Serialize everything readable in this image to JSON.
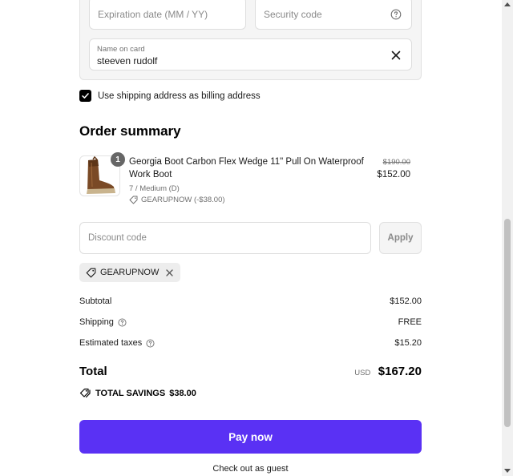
{
  "card": {
    "expiration_placeholder": "Expiration date (MM / YY)",
    "security_placeholder": "Security code",
    "name_label": "Name on card",
    "name_value": "steeven rudolf"
  },
  "billing": {
    "checkbox_label": "Use shipping address as billing address",
    "checked": true
  },
  "summary": {
    "title": "Order summary",
    "item": {
      "quantity": "1",
      "name": "Georgia Boot Carbon Flex Wedge 11\" Pull On Waterproof Work Boot",
      "variant": "7 / Medium (D)",
      "discount": "GEARUPNOW (-$38.00)",
      "original_price": "$190.00",
      "price": "$152.00"
    },
    "discount_placeholder": "Discount code",
    "apply_label": "Apply",
    "applied_code": "GEARUPNOW",
    "rows": {
      "subtotal_label": "Subtotal",
      "subtotal_value": "$152.00",
      "shipping_label": "Shipping",
      "shipping_value": "FREE",
      "taxes_label": "Estimated taxes",
      "taxes_value": "$15.20"
    },
    "total_label": "Total",
    "currency": "USD",
    "total_value": "$167.20",
    "savings_label": "TOTAL SAVINGS",
    "savings_value": "$38.00"
  },
  "actions": {
    "pay_label": "Pay now",
    "guest_label": "Check out as guest"
  },
  "colors": {
    "accent": "#5a31f4",
    "checkbox": "#000000"
  }
}
